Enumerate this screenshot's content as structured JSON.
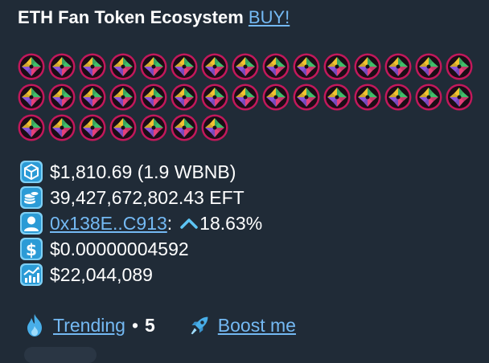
{
  "header": {
    "title": "ETH Fan Token Ecosystem",
    "buy_label": "BUY!"
  },
  "token_icons": {
    "count": 37,
    "icon": "eft-token-icon",
    "colors": {
      "ring": "#c2185b",
      "center": "#1a0d16",
      "petals": [
        "#f2c230",
        "#3fbf6a",
        "#e6407a",
        "#8a55d9"
      ]
    }
  },
  "stats": {
    "market_cap_text": "$1,810.69 (1.9 WBNB)",
    "supply_text": "39,427,672,802.43 EFT",
    "buyer_address": "0x138E..C913",
    "colon": ":",
    "change_text": "18.63%",
    "price_text": "$0.00000004592",
    "volume_text": "$22,044,089"
  },
  "icons": {
    "market_cap": "box-cube-icon",
    "supply": "coins-icon",
    "buyer": "user-icon",
    "price": "dollar-icon",
    "volume": "chart-up-icon",
    "change": "caret-up-icon",
    "trending": "fire-icon",
    "boost": "rocket-icon"
  },
  "footer": {
    "trending_label": "Trending",
    "separator": "•",
    "trending_rank": "5",
    "boost_label": "Boost me"
  },
  "theme": {
    "background": "#202b37",
    "link": "#74b9f3",
    "icon_blue": "#5dc5f5"
  }
}
